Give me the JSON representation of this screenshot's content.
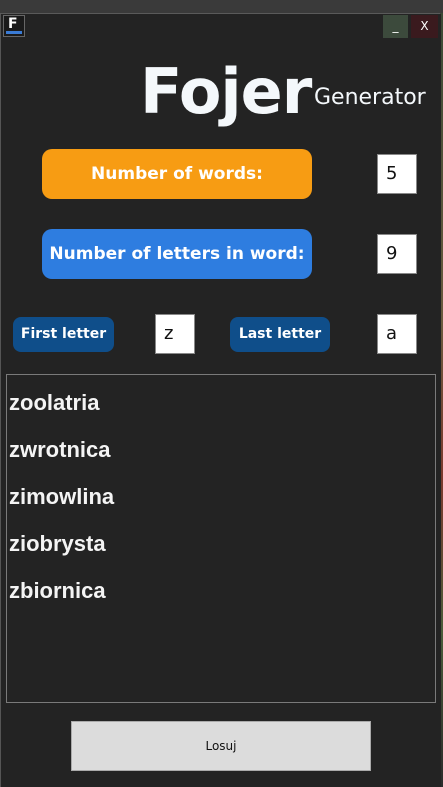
{
  "window": {
    "app_icon_letter": "F",
    "minimize_label": "_",
    "close_label": "X"
  },
  "header": {
    "title": "Fojer",
    "subtitle": "Generator"
  },
  "controls": {
    "words_label": "Number of words:",
    "words_value": "5",
    "letters_label": "Number of letters in word:",
    "letters_value": "9",
    "first_letter_label": "First letter",
    "first_letter_value": "z",
    "last_letter_label": "Last letter",
    "last_letter_value": "a"
  },
  "results": [
    "zoolatria",
    "zwrotnica",
    "zimowlina",
    "ziobrysta",
    "zbiornica"
  ],
  "actions": {
    "generate_label": "Losuj"
  },
  "colors": {
    "orange": "#f79c13",
    "blue": "#2e7de0",
    "dark_blue": "#0f4e8a",
    "background": "#232323"
  }
}
